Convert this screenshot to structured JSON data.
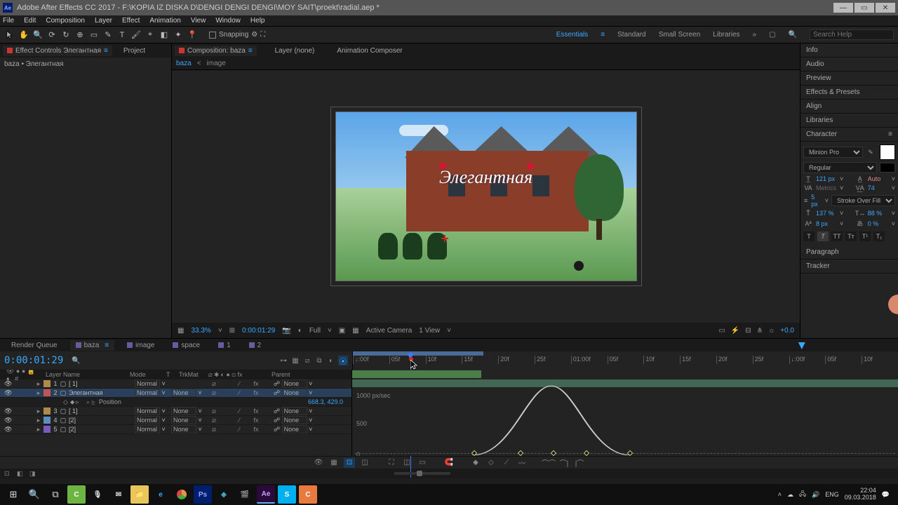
{
  "titlebar": {
    "app": "Ae",
    "title": "Adobe After Effects CC 2017 - F:\\KOPIA IZ DISKA D\\DENGI DENGI DENGI\\MOY SAIT\\proekt\\radial.aep *"
  },
  "menubar": [
    "File",
    "Edit",
    "Composition",
    "Layer",
    "Effect",
    "Animation",
    "View",
    "Window",
    "Help"
  ],
  "toolbar": {
    "snapping": "Snapping"
  },
  "workspaces": {
    "items": [
      "Essentials",
      "Standard",
      "Small Screen",
      "Libraries"
    ],
    "search_placeholder": "Search Help"
  },
  "left_panel": {
    "tabs": [
      "Effect Controls Элегантная",
      "Project"
    ],
    "body_line": "baza • Элегантная"
  },
  "center": {
    "tabs": [
      "Composition: baza",
      "Layer (none)",
      "Animation Composer"
    ],
    "nav": {
      "comp": "baza",
      "sep": "<",
      "target": "image"
    },
    "overlay_text": "Элегантная"
  },
  "viewer_controls": {
    "zoom": "33.3%",
    "res": "Full",
    "time": "0:00:01:29",
    "camera": "Active Camera",
    "view": "1 View",
    "exp": "+0.0"
  },
  "right_panel": {
    "sections": [
      "Info",
      "Audio",
      "Preview",
      "Effects & Presets",
      "Align",
      "Libraries",
      "Character",
      "Paragraph",
      "Tracker"
    ],
    "character": {
      "font": "Minion Pro",
      "style": "Regular",
      "size": "121 px",
      "size_unit": "px",
      "leading": "Auto",
      "kerning": "Metrics",
      "tracking": "74",
      "stroke": "5 px",
      "stroke_unit": "px",
      "fill_opt": "Stroke Over Fill",
      "vscale": "137 %",
      "hscale": "88 %",
      "baseline": "8 px",
      "tsume": "0 %"
    }
  },
  "timeline": {
    "tabs": [
      "Render Queue",
      "baza",
      "image",
      "space",
      "1",
      "2"
    ],
    "timecode": "0:00:01:29",
    "columns": {
      "layer_name": "Layer Name",
      "mode": "Mode",
      "t": "T",
      "trkmat": "TrkMat",
      "parent": "Parent"
    },
    "layers": [
      {
        "n": "1",
        "name": "[ 1]",
        "color": "#b08a4a",
        "mode": "Normal",
        "trk": "",
        "parent": "None"
      },
      {
        "n": "2",
        "name": "Элегантная",
        "color": "#c05555",
        "mode": "Normal",
        "trk": "None",
        "parent": "None",
        "selected": true
      },
      {
        "prop": true,
        "name": "Position",
        "value": "668.3, 429.0"
      },
      {
        "n": "3",
        "name": "[ 1]",
        "color": "#b08a4a",
        "mode": "Normal",
        "trk": "None",
        "parent": "None"
      },
      {
        "n": "4",
        "name": "[2]",
        "color": "#5a8fbf",
        "mode": "Normal",
        "trk": "None",
        "parent": "None"
      },
      {
        "n": "5",
        "name": "[2]",
        "color": "#7a5abf",
        "mode": "Normal",
        "trk": "None",
        "parent": "None"
      }
    ],
    "ruler": [
      "↓:00f",
      "05f",
      "10f",
      "15f",
      "20f",
      "25f",
      "01:00f",
      "05f",
      "10f",
      "15f",
      "20f",
      "25f",
      "↓:00f",
      "05f",
      "10f"
    ],
    "graph_labels": {
      "y1": "1000 px/sec",
      "y2": "500",
      "y3": "0"
    }
  },
  "taskbar": {
    "lang": "ENG",
    "time": "22:04",
    "date": "09.03.2018"
  }
}
